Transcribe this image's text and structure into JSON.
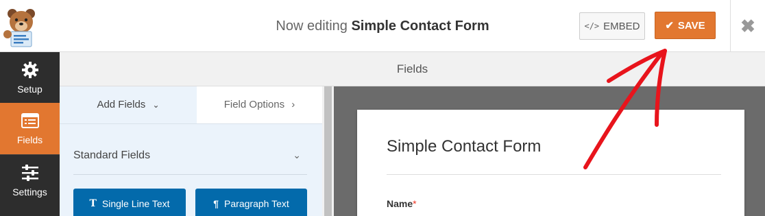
{
  "header": {
    "editing_prefix": "Now editing",
    "form_name": "Simple Contact Form",
    "embed_label": "EMBED",
    "save_label": "SAVE",
    "close_icon": "close-icon",
    "embed_icon": "code-icon",
    "save_icon": "check-icon"
  },
  "sidebar": {
    "items": [
      {
        "label": "Setup",
        "icon": "gear-icon",
        "active": false
      },
      {
        "label": "Fields",
        "icon": "fields-list-icon",
        "active": true
      },
      {
        "label": "Settings",
        "icon": "sliders-icon",
        "active": false
      }
    ]
  },
  "main": {
    "section_title": "Fields"
  },
  "panel": {
    "tabs": [
      {
        "label": "Add Fields",
        "icon": "chevron-down-icon",
        "active": true
      },
      {
        "label": "Field Options",
        "icon": "chevron-right-icon",
        "active": false
      }
    ],
    "group_title": "Standard Fields",
    "buttons": [
      {
        "label": "Single Line Text",
        "icon": "text-cursor-icon"
      },
      {
        "label": "Paragraph Text",
        "icon": "paragraph-icon"
      }
    ]
  },
  "preview": {
    "form_title": "Simple Contact Form",
    "fields": [
      {
        "label": "Name",
        "required_mark": "*"
      }
    ]
  },
  "colors": {
    "accent": "#e27730",
    "sidebar_bg": "#2d2d2d",
    "field_button": "#036aab",
    "annotation_arrow": "#e8141c"
  }
}
